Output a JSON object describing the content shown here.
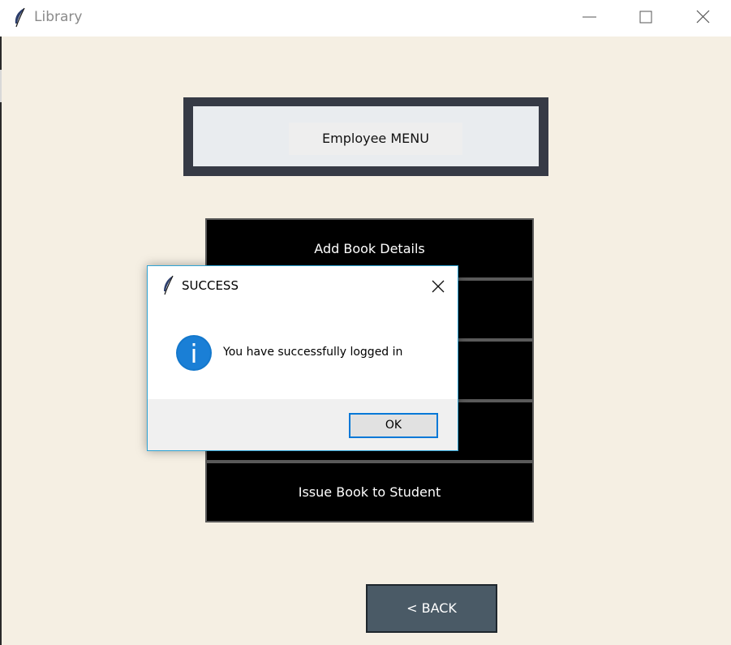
{
  "window": {
    "title": "Library",
    "icon": "feather-icon"
  },
  "header": {
    "label": "Employee MENU"
  },
  "menu": {
    "items": [
      {
        "label": "Add Book Details"
      },
      {
        "label": ""
      },
      {
        "label": ""
      },
      {
        "label": ""
      },
      {
        "label": "Issue Book to Student"
      }
    ]
  },
  "back_button": {
    "label": "<  BACK"
  },
  "dialog": {
    "title": "SUCCESS",
    "message": "You have successfully logged in",
    "ok_label": "OK",
    "icon": "info-icon"
  },
  "colors": {
    "background": "#f5efe3",
    "header_frame": "#363a45",
    "menu_button": "#000000",
    "back_button": "#4a5a66",
    "info_blue": "#1478cc",
    "focus_border": "#0078d7"
  }
}
